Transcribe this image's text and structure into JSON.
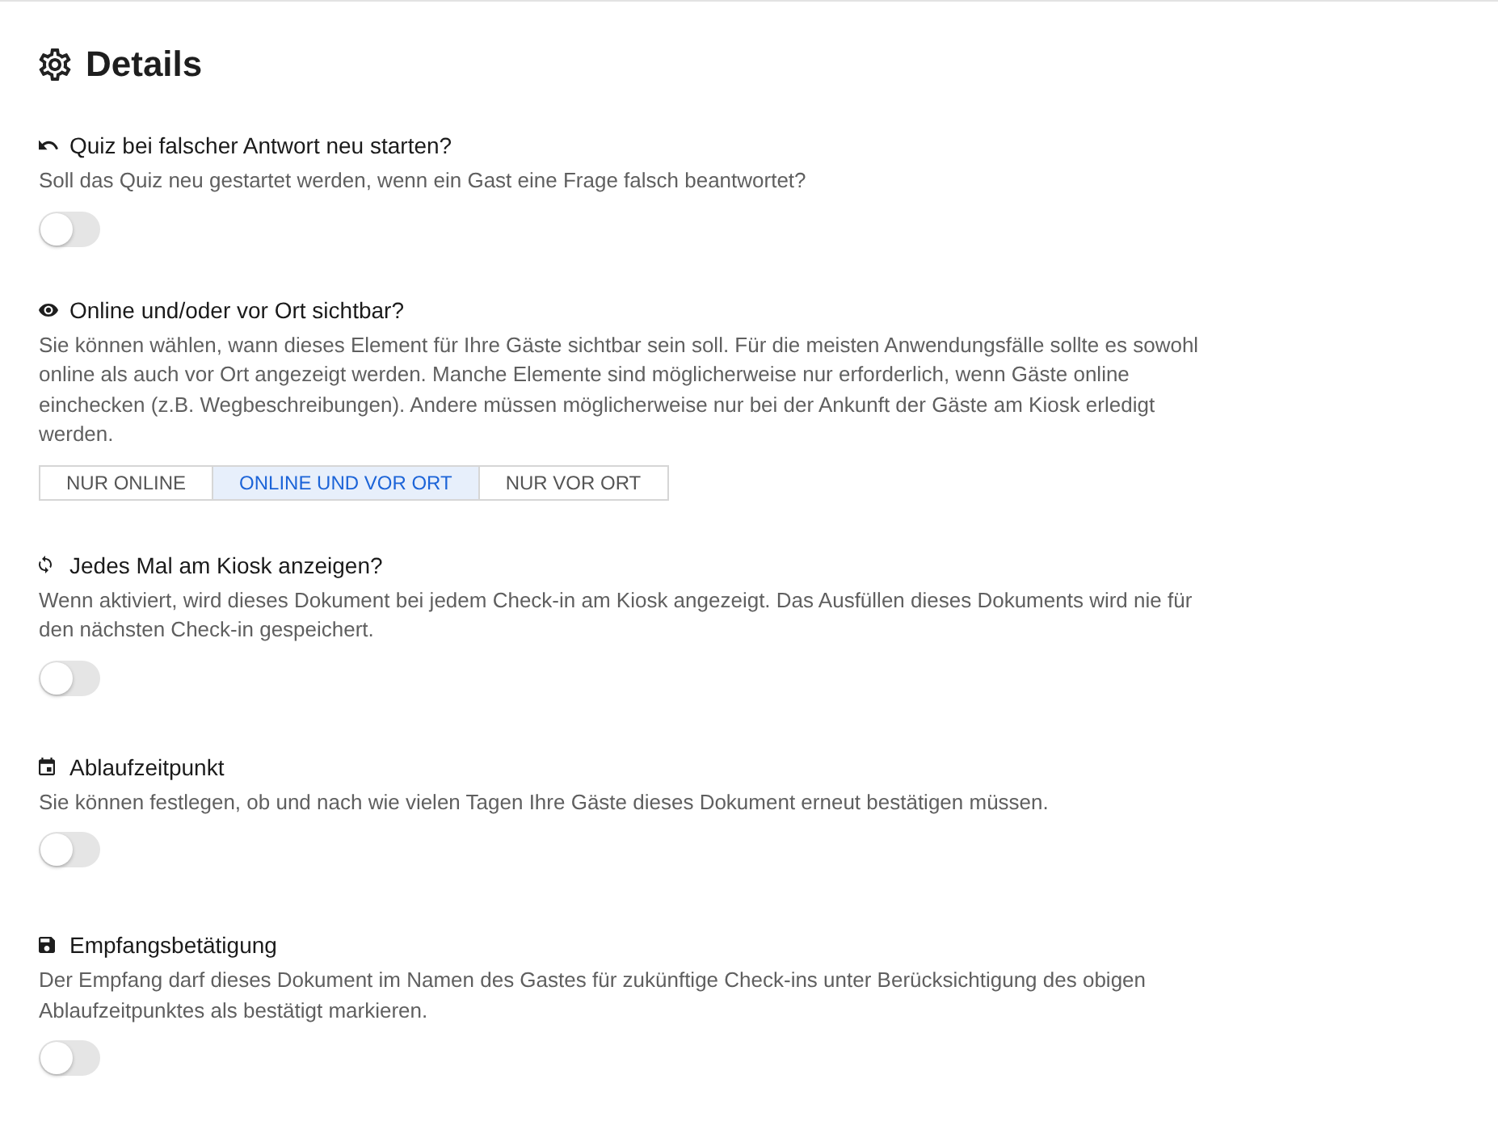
{
  "title": "Details",
  "sections": [
    {
      "kind": "toggle",
      "title": "Quiz bei falscher Antwort neu starten?",
      "description": "Soll das Quiz neu gestartet werden, wenn ein Gast eine Frage falsch beantwortet?",
      "on": false
    },
    {
      "kind": "segmented",
      "title": "Online und/oder vor Ort sichtbar?",
      "description": "Sie können wählen, wann dieses Element für Ihre Gäste sichtbar sein soll. Für die meisten Anwendungsfälle sollte es sowohl online als auch vor Ort angezeigt werden. Manche Elemente sind möglicherweise nur erforderlich, wenn Gäste online einchecken (z.B. Wegbeschreibungen). Andere müssen möglicherweise nur bei der Ankunft der Gäste am Kiosk erledigt werden.",
      "options": [
        {
          "label": "NUR ONLINE",
          "selected": false
        },
        {
          "label": "ONLINE UND VOR ORT",
          "selected": true
        },
        {
          "label": "NUR VOR ORT",
          "selected": false
        }
      ]
    },
    {
      "kind": "toggle",
      "title": "Jedes Mal am Kiosk anzeigen?",
      "description": "Wenn aktiviert, wird dieses Dokument bei jedem Check-in am Kiosk angezeigt. Das Ausfüllen dieses Dokuments wird nie für den nächsten Check-in gespeichert.",
      "on": false
    },
    {
      "kind": "toggle",
      "title": "Ablaufzeitpunkt",
      "description": "Sie können festlegen, ob und nach wie vielen Tagen Ihre Gäste dieses Dokument erneut bestätigen müssen.",
      "on": false
    },
    {
      "kind": "toggle",
      "title": "Empfangsbetätigung",
      "description": "Der Empfang darf dieses Dokument im Namen des Gastes für zukünftige Check-ins unter Berücksichtigung des obigen Ablaufzeitpunktes als bestätigt markieren.",
      "on": false
    }
  ]
}
